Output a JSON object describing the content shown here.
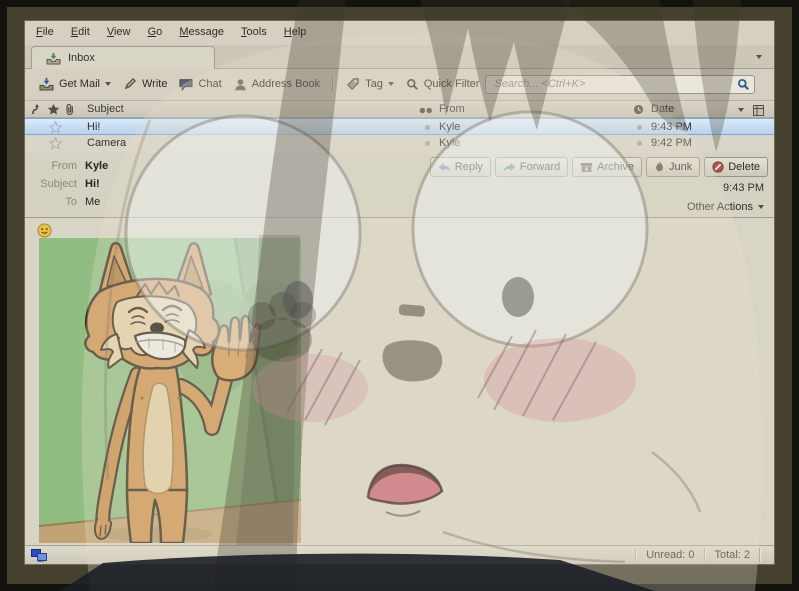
{
  "menu": {
    "items": [
      {
        "label": "File"
      },
      {
        "label": "Edit"
      },
      {
        "label": "View"
      },
      {
        "label": "Go"
      },
      {
        "label": "Message"
      },
      {
        "label": "Tools"
      },
      {
        "label": "Help"
      }
    ]
  },
  "tabbar": {
    "inbox_label": "Inbox"
  },
  "toolbar": {
    "get_mail": "Get Mail",
    "write": "Write",
    "chat": "Chat",
    "address_book": "Address Book",
    "tag": "Tag",
    "quick_filter": "Quick Filter",
    "search_placeholder": "Search... <Ctrl+K>"
  },
  "list": {
    "columns": {
      "subject": "Subject",
      "from": "From",
      "date": "Date"
    },
    "rows": [
      {
        "subject": "Hi!",
        "from": "Kyle",
        "date": "9:43 PM"
      },
      {
        "subject": "Camera",
        "from": "Kyle",
        "date": "9:42 PM"
      }
    ]
  },
  "message": {
    "from_label": "From",
    "from_value": "Kyle",
    "subject_label": "Subject",
    "subject_value": "Hi!",
    "to_label": "To",
    "to_value": "Me",
    "time": "9:43 PM",
    "actions": {
      "reply": "Reply",
      "forward": "Forward",
      "archive": "Archive",
      "junk": "Junk",
      "delete": "Delete"
    },
    "other_actions": "Other Actions"
  },
  "statusbar": {
    "unread": "Unread: 0",
    "total": "Total: 2"
  },
  "colors": {
    "window_bg": "#d5d0c2",
    "frame": "#46412f",
    "selection_top": "#dceafa",
    "selection_bottom": "#b6d3ec",
    "selection_border": "#7fa9d2",
    "wall_green": "#90bd81",
    "floor_tan": "#c2a474",
    "fox_fur": "#cf9350",
    "fox_cream": "#e6d2aa",
    "search_icon_blue": "#2f5a8f",
    "status_icon_blue": "#2f4fc0"
  }
}
